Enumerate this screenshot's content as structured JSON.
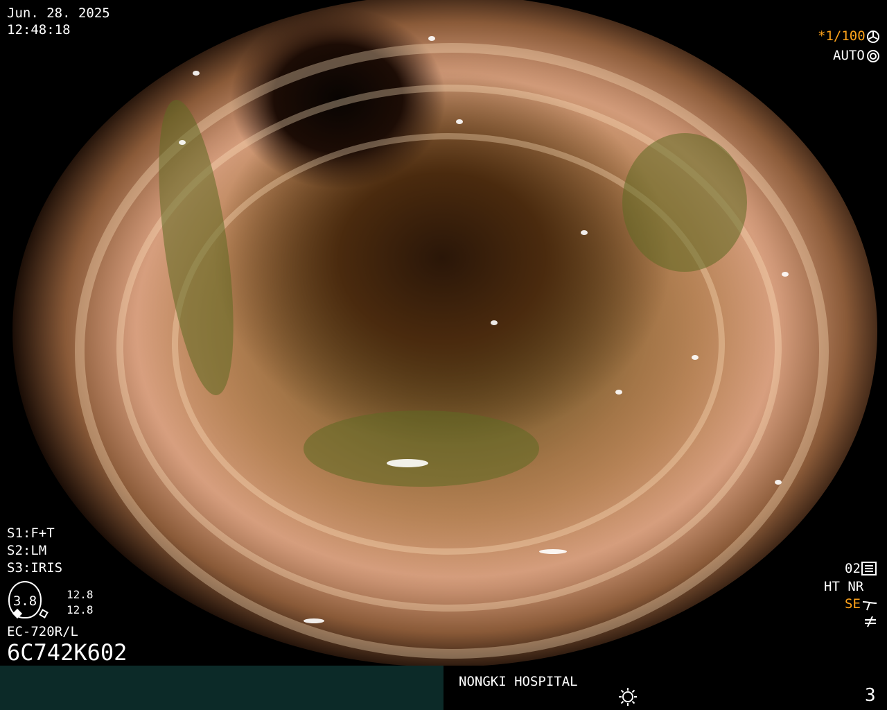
{
  "overlay": {
    "date": "Jun. 28. 2025",
    "time": "12:48:18",
    "shutter": "*1/100",
    "iris_mode": "AUTO",
    "settings": [
      "S1:F+T",
      "S2:LM",
      "S3:IRIS"
    ],
    "zoom_value": "3.8",
    "zoom_readings": [
      "12.8",
      "12.8"
    ],
    "scope_model": "EC-720R/L",
    "serial": "6C742K602",
    "preset": "02",
    "enhancement": "HT NR",
    "se_label": "SE",
    "hospital": "NONGKI HOSPITAL",
    "page_number": "3"
  },
  "colors": {
    "accent_orange": "#ffa31a",
    "bottom_bar": "#0c2a28"
  },
  "icons": [
    "fan-icon",
    "aperture-icon",
    "settings-sliders-icon",
    "se-curve-icon",
    "not-equal-icon",
    "light-source-icon"
  ]
}
